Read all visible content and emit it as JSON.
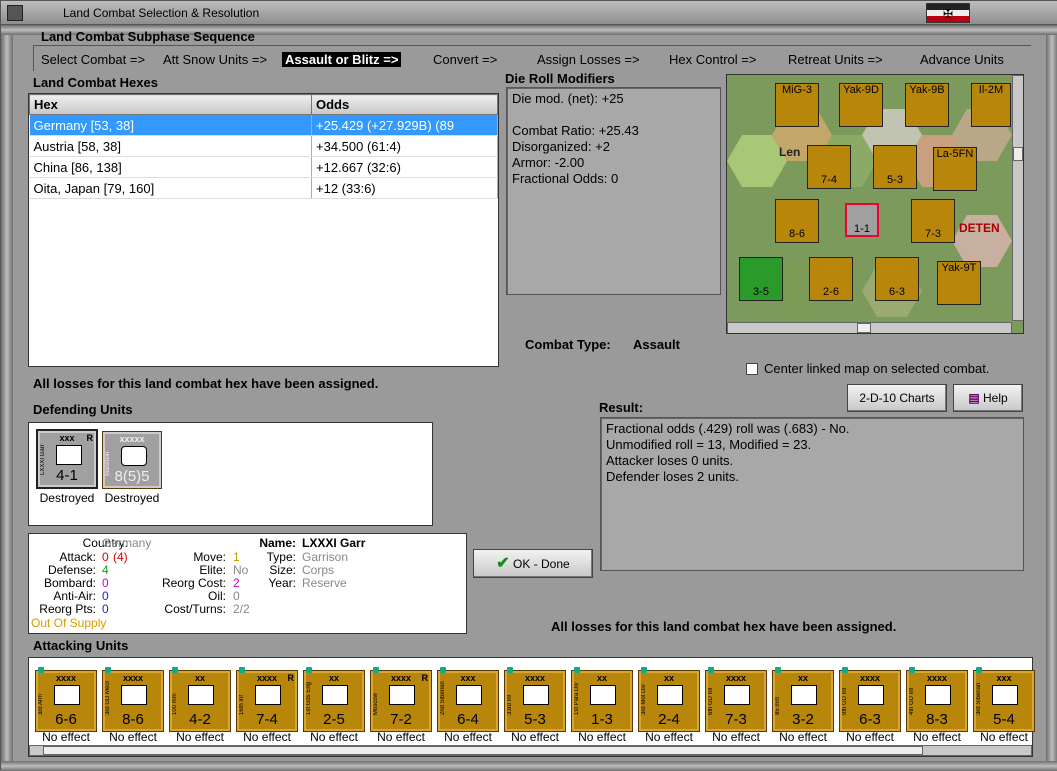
{
  "window": {
    "title": "Land Combat Selection & Resolution",
    "flag_symbol": "✠"
  },
  "subphase": {
    "heading": "Land Combat Subphase Sequence",
    "steps": [
      "Select Combat =>",
      "Att Snow Units =>",
      "Assault or Blitz =>",
      "Convert =>",
      "Assign Losses =>",
      "Hex Control =>",
      "Retreat Units =>",
      "Advance Units"
    ],
    "active_index": 2
  },
  "hexes": {
    "heading": "Land Combat Hexes",
    "columns": [
      "Hex",
      "Odds"
    ],
    "rows": [
      {
        "hex": "Germany [53, 38]",
        "odds": "+25.429 (+27.929B) (89"
      },
      {
        "hex": "Austria [58, 38]",
        "odds": "+34.500 (61:4)"
      },
      {
        "hex": "China [86, 138]",
        "odds": "+12.667 (32:6)"
      },
      {
        "hex": "Oita, Japan [79, 160]",
        "odds": "+12 (33:6)"
      }
    ],
    "selected_index": 0
  },
  "modifiers": {
    "heading": "Die Roll Modifiers",
    "lines": [
      "Die mod. (net): +25",
      "",
      "Combat Ratio: +25.43",
      "Disorganized: +2",
      "Armor: -2.00",
      "Fractional Odds: 0"
    ]
  },
  "combat_type": {
    "label": "Combat Type:",
    "value": "Assault"
  },
  "map": {
    "center_label": "Center linked map on selected combat.",
    "texts": [
      "MiG-3",
      "Yak-9D",
      "Yak-9B",
      "Il-2M",
      "La-5FN",
      "Yak-9T",
      "Len",
      "DETEN",
      "7-4",
      "5-3",
      "8-6",
      "7-3",
      "3-5",
      "2-6",
      "6-3",
      "1-1"
    ]
  },
  "buttons": {
    "charts": "2-D-10 Charts",
    "help": "Help",
    "ok": "OK - Done"
  },
  "losses_msg": "All losses for this land combat hex have been assigned.",
  "defending": {
    "heading": "Defending Units",
    "units": [
      {
        "size": "xxx",
        "name": "LXXXI Garr",
        "str": "4-1",
        "status": "Destroyed",
        "r": "R"
      },
      {
        "size": "xxxxx",
        "name": "Manstein",
        "str": "8(5)5",
        "status": "Destroyed",
        "r": ""
      }
    ]
  },
  "result": {
    "heading": "Result:",
    "lines": [
      "Fractional odds (.429) roll was (.683)  - No.",
      "Unmodified roll = 13, Modified = 23.",
      "Attacker loses 0 units.",
      "Defender loses 2 units."
    ]
  },
  "details": {
    "country_label": "Country:",
    "country": "Germany",
    "attack_label": "Attack:",
    "attack": "0",
    "attack_paren": "(4)",
    "defense_label": "Defense:",
    "defense": "4",
    "bombard_label": "Bombard:",
    "bombard": "0",
    "antiair_label": "Anti-Air:",
    "antiair": "0",
    "reorgpts_label": "Reorg Pts:",
    "reorgpts": "0",
    "supply": "Out Of Supply",
    "move_label": "Move:",
    "move": "1",
    "elite_label": "Elite:",
    "elite": "No",
    "reorgcost_label": "Reorg Cost:",
    "reorgcost": "2",
    "oil_label": "Oil:",
    "oil": "0",
    "costturns_label": "Cost/Turns:",
    "costturns": "2/2",
    "name_label": "Name:",
    "name": "LXXXI Garr",
    "type_label": "Type:",
    "type": "Garrison",
    "size_label": "Size:",
    "size": "Corps",
    "year_label": "Year:",
    "year": "Reserve"
  },
  "attacking": {
    "heading": "Attacking Units",
    "units": [
      {
        "size": "xxxx",
        "name": "3rd Arm",
        "str": "6-6",
        "status": "No effect",
        "r": ""
      },
      {
        "size": "xxxx",
        "name": "3rd GD Mech",
        "str": "8-6",
        "status": "No effect",
        "r": ""
      },
      {
        "size": "xx",
        "name": "100 mm",
        "str": "4-2",
        "status": "No effect",
        "r": ""
      },
      {
        "size": "xxxx",
        "name": "16th Inf",
        "str": "7-4",
        "status": "No effect",
        "r": "R"
      },
      {
        "size": "xx",
        "name": "1st Gds Eng",
        "str": "2-5",
        "status": "No effect",
        "r": ""
      },
      {
        "size": "xxxx",
        "name": "Moscow",
        "str": "7-2",
        "status": "No effect",
        "r": "R"
      },
      {
        "size": "xxx",
        "name": "2nd Siberian",
        "str": "6-4",
        "status": "No effect",
        "r": ""
      },
      {
        "size": "xxxx",
        "name": "33rd Inf",
        "str": "5-3",
        "status": "No effect",
        "r": ""
      },
      {
        "size": "xx",
        "name": "1st Para Div",
        "str": "1-3",
        "status": "No effect",
        "r": ""
      },
      {
        "size": "xx",
        "name": "3rd Mot Div",
        "str": "2-4",
        "status": "No effect",
        "r": ""
      },
      {
        "size": "xxxx",
        "name": "6th GD Inf",
        "str": "7-3",
        "status": "No effect",
        "r": ""
      },
      {
        "size": "xx",
        "name": "85 mm",
        "str": "3-2",
        "status": "No effect",
        "r": ""
      },
      {
        "size": "xxxx",
        "name": "9th GD Inf",
        "str": "6-3",
        "status": "No effect",
        "r": ""
      },
      {
        "size": "xxxx",
        "name": "4th GD Inf",
        "str": "8-3",
        "status": "No effect",
        "r": ""
      },
      {
        "size": "xxx",
        "name": "3rd Siberian",
        "str": "5-4",
        "status": "No effect",
        "r": ""
      }
    ]
  },
  "colors": {
    "counter": "#b8860b",
    "selected_row": "#3399ff",
    "german_counter": "#a0a0a0"
  }
}
